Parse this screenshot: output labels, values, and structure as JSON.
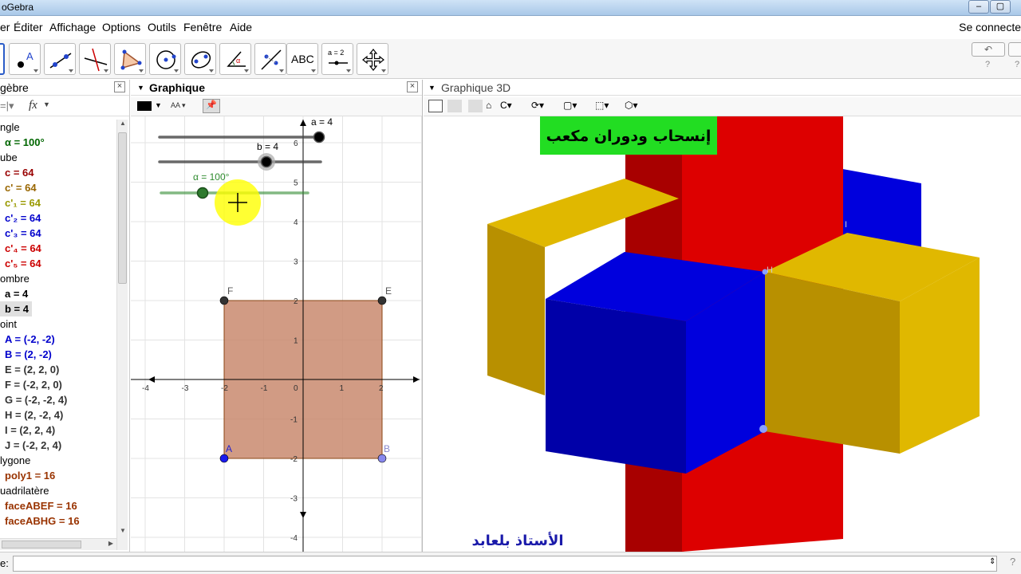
{
  "window": {
    "title": "oGebra"
  },
  "menu": {
    "items": [
      "er",
      "Éditer",
      "Affichage",
      "Options",
      "Outils",
      "Fenêtre",
      "Aide"
    ],
    "login": "Se connecte"
  },
  "toolbar": {
    "tool_labels": {
      "text_tool": "ABC",
      "slider_tool": "a = 2"
    },
    "undo": "↶",
    "redo": "↷",
    "help": "?"
  },
  "algebra": {
    "title": "gèbre",
    "fx": "fx",
    "rows": [
      {
        "type": "cat",
        "text": "ngle"
      },
      {
        "type": "obj",
        "text": "α = 100°",
        "color": "#006600"
      },
      {
        "type": "cat",
        "text": "ube"
      },
      {
        "type": "obj",
        "text": "c = 64",
        "color": "#990000"
      },
      {
        "type": "obj",
        "text": "c' = 64",
        "color": "#996600"
      },
      {
        "type": "obj",
        "text": "c'₁ = 64",
        "color": "#999900"
      },
      {
        "type": "obj",
        "text": "c'₂ = 64",
        "color": "#0000cc"
      },
      {
        "type": "obj",
        "text": "c'₃ = 64",
        "color": "#0000cc"
      },
      {
        "type": "obj",
        "text": "c'₄ = 64",
        "color": "#cc0000"
      },
      {
        "type": "obj",
        "text": "c'₅ = 64",
        "color": "#cc0000"
      },
      {
        "type": "cat",
        "text": "ombre"
      },
      {
        "type": "obj",
        "text": "a = 4",
        "color": "#000000"
      },
      {
        "type": "obj",
        "text": "b = 4",
        "color": "#000000",
        "highlight": true
      },
      {
        "type": "cat",
        "text": "oint"
      },
      {
        "type": "obj",
        "text": "A = (-2, -2)",
        "color": "#0000cc"
      },
      {
        "type": "obj",
        "text": "B = (2, -2)",
        "color": "#0000cc"
      },
      {
        "type": "obj",
        "text": "E = (2, 2, 0)",
        "color": "#333333"
      },
      {
        "type": "obj",
        "text": "F = (-2, 2, 0)",
        "color": "#333333"
      },
      {
        "type": "obj",
        "text": "G = (-2, -2, 4)",
        "color": "#333333"
      },
      {
        "type": "obj",
        "text": "H = (2, -2, 4)",
        "color": "#333333"
      },
      {
        "type": "obj",
        "text": "I = (2, 2, 4)",
        "color": "#333333"
      },
      {
        "type": "obj",
        "text": "J = (-2, 2, 4)",
        "color": "#333333"
      },
      {
        "type": "cat",
        "text": "lygone"
      },
      {
        "type": "obj",
        "text": "poly1 = 16",
        "color": "#993300"
      },
      {
        "type": "cat",
        "text": "uadrilatère"
      },
      {
        "type": "obj",
        "text": "faceABEF = 16",
        "color": "#993300"
      },
      {
        "type": "obj",
        "text": "faceABHG = 16",
        "color": "#993300"
      }
    ]
  },
  "graphics2d": {
    "title": "Graphique",
    "sliders": {
      "a": "a = 4",
      "b": "b = 4",
      "alpha": "α = 100°"
    },
    "point_labels": {
      "A": "A",
      "B": "B",
      "F": "F",
      "E": "E"
    },
    "x_ticks": [
      "-4",
      "-3",
      "-2",
      "-1",
      "0",
      "1",
      "2"
    ],
    "y_ticks": [
      "6",
      "5",
      "4",
      "3",
      "2",
      "1",
      "-1",
      "-2",
      "-3",
      "-4"
    ],
    "colors": {
      "square_fill": "#c98a6e",
      "slider_ab": "#444444",
      "slider_alpha": "#2e8b2e",
      "highlight": "#ffff00"
    }
  },
  "graphics3d": {
    "title": "Graphique 3D",
    "banner": "إنسحاب ودوران مكعب",
    "author": "الأستاذ بلعابد",
    "vertex_labels": {
      "H": "H",
      "I": "I"
    },
    "colors": {
      "red": "#dd0000",
      "dark_red": "#a80000",
      "blue": "#0000dd",
      "dark_blue": "#0000a8",
      "yellow": "#e0b800",
      "dark_yellow": "#b89000",
      "banner_bg": "#22dd22"
    }
  },
  "input": {
    "label": "e:",
    "value": ""
  }
}
